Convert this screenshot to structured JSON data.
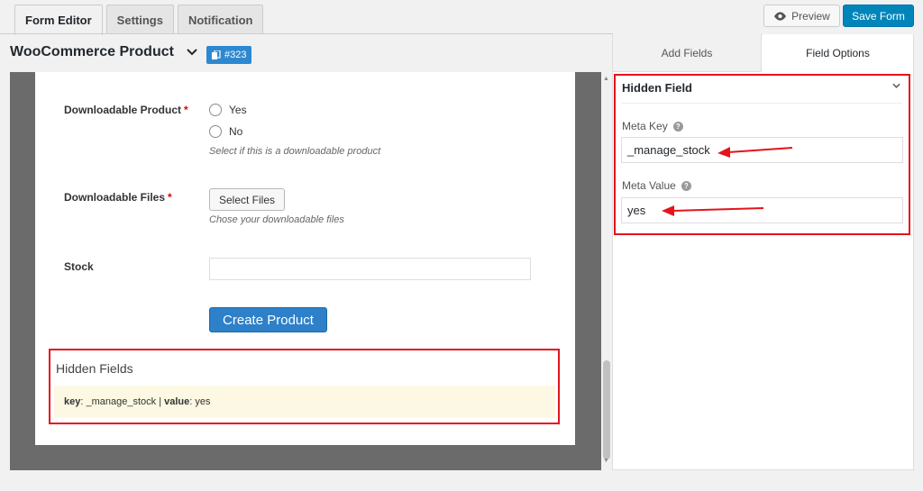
{
  "tabs": [
    {
      "label": "Form Editor"
    },
    {
      "label": "Settings"
    },
    {
      "label": "Notification"
    }
  ],
  "toolbar": {
    "preview_label": "Preview",
    "save_label": "Save Form"
  },
  "form": {
    "title": "WooCommerce Product",
    "id_badge": "#323"
  },
  "fields": {
    "downloadable_product": {
      "label": "Downloadable Product",
      "required": "*",
      "option_yes": "Yes",
      "option_no": "No",
      "help": "Select if this is a downloadable product"
    },
    "downloadable_files": {
      "label": "Downloadable Files",
      "required": "*",
      "button": "Select Files",
      "help": "Chose your downloadable files"
    },
    "stock": {
      "label": "Stock",
      "value": ""
    },
    "submit": "Create Product"
  },
  "hidden_fields": {
    "title": "Hidden Fields",
    "key_label": "key",
    "key_value": ": _manage_stock | ",
    "value_label": "value",
    "value_value": ": yes"
  },
  "right_panel": {
    "tabs": [
      {
        "label": "Add Fields"
      },
      {
        "label": "Field Options"
      }
    ],
    "active_tab": "Field Options",
    "section_title": "Hidden Field",
    "meta_key_label": "Meta Key",
    "meta_key_value": "_manage_stock",
    "meta_value_label": "Meta Value",
    "meta_value_value": "yes"
  },
  "colors": {
    "highlight": "#e3141c",
    "primary": "#0085ba",
    "badge": "#2e88d0",
    "notice_bg": "#fcf8e3"
  }
}
